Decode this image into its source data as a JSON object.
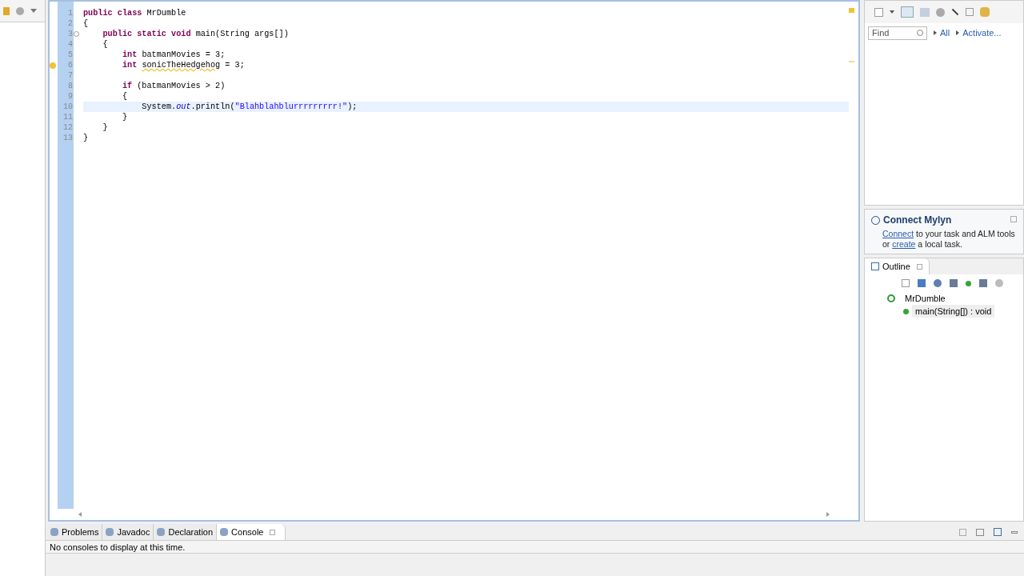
{
  "editor": {
    "lines": [
      {
        "number": "1",
        "current": false,
        "warning": false,
        "foldable": false,
        "tokens": [
          {
            "kind": "keyword",
            "text": "public class "
          },
          {
            "kind": "plain",
            "text": "MrDumble"
          }
        ]
      },
      {
        "number": "2",
        "current": false,
        "warning": false,
        "foldable": false,
        "tokens": [
          {
            "kind": "plain",
            "text": "{"
          }
        ]
      },
      {
        "number": "3",
        "current": false,
        "warning": false,
        "foldable": true,
        "tokens": [
          {
            "kind": "keyword",
            "text": "    public static void "
          },
          {
            "kind": "plain",
            "text": "main(String args[])"
          }
        ]
      },
      {
        "number": "4",
        "current": false,
        "warning": false,
        "foldable": false,
        "tokens": [
          {
            "kind": "plain",
            "text": "    {"
          }
        ]
      },
      {
        "number": "5",
        "current": false,
        "warning": false,
        "foldable": false,
        "tokens": [
          {
            "kind": "keyword",
            "text": "        int "
          },
          {
            "kind": "plain",
            "text": "batmanMovies = 3;"
          }
        ]
      },
      {
        "number": "6",
        "current": false,
        "warning": true,
        "foldable": false,
        "tokens": [
          {
            "kind": "keyword",
            "text": "        int "
          },
          {
            "kind": "warning",
            "text": "sonicTheHedgehog"
          },
          {
            "kind": "plain",
            "text": " = 3;"
          }
        ]
      },
      {
        "number": "7",
        "current": false,
        "warning": false,
        "foldable": false
      },
      {
        "number": "8",
        "current": false,
        "warning": false,
        "foldable": false,
        "tokens": [
          {
            "kind": "keyword",
            "text": "        if "
          },
          {
            "kind": "plain",
            "text": "(batmanMovies > 2)"
          }
        ]
      },
      {
        "number": "9",
        "current": false,
        "warning": false,
        "foldable": false,
        "tokens": [
          {
            "kind": "plain",
            "text": "        {"
          }
        ]
      },
      {
        "number": "10",
        "current": true,
        "warning": false,
        "foldable": false,
        "tokens": [
          {
            "kind": "plain",
            "text": "            System."
          },
          {
            "kind": "field",
            "text": "out"
          },
          {
            "kind": "plain",
            "text": ".println("
          },
          {
            "kind": "string",
            "text": "\"Blahblahblurrrrrrrrr!\""
          },
          {
            "kind": "plain",
            "text": ");"
          }
        ]
      },
      {
        "number": "11",
        "current": false,
        "warning": false,
        "foldable": false,
        "tokens": [
          {
            "kind": "plain",
            "text": "        }"
          }
        ]
      },
      {
        "number": "12",
        "current": false,
        "warning": false,
        "foldable": false,
        "tokens": [
          {
            "kind": "plain",
            "text": "    }"
          }
        ]
      },
      {
        "number": "13",
        "current": false,
        "warning": false,
        "foldable": false,
        "tokens": [
          {
            "kind": "plain",
            "text": "}"
          }
        ]
      }
    ]
  },
  "task_list": {
    "find_placeholder": "Find",
    "links": [
      "All",
      "Activate..."
    ]
  },
  "mylyn": {
    "title": "Connect Mylyn",
    "link1": "Connect",
    "text1": " to your task and ALM tools",
    "text2": "or ",
    "link2": "create",
    "text3": " a local task."
  },
  "outline": {
    "tab": "Outline",
    "items": [
      {
        "label": "MrDumble",
        "children": [
          {
            "label": "main(String[]) : void"
          }
        ]
      }
    ]
  },
  "bottom": {
    "tabs": [
      {
        "label": "Problems",
        "selected": false
      },
      {
        "label": "Javadoc",
        "selected": false
      },
      {
        "label": "Declaration",
        "selected": false
      },
      {
        "label": "Console",
        "selected": true
      }
    ],
    "message": "No consoles to display at this time."
  }
}
